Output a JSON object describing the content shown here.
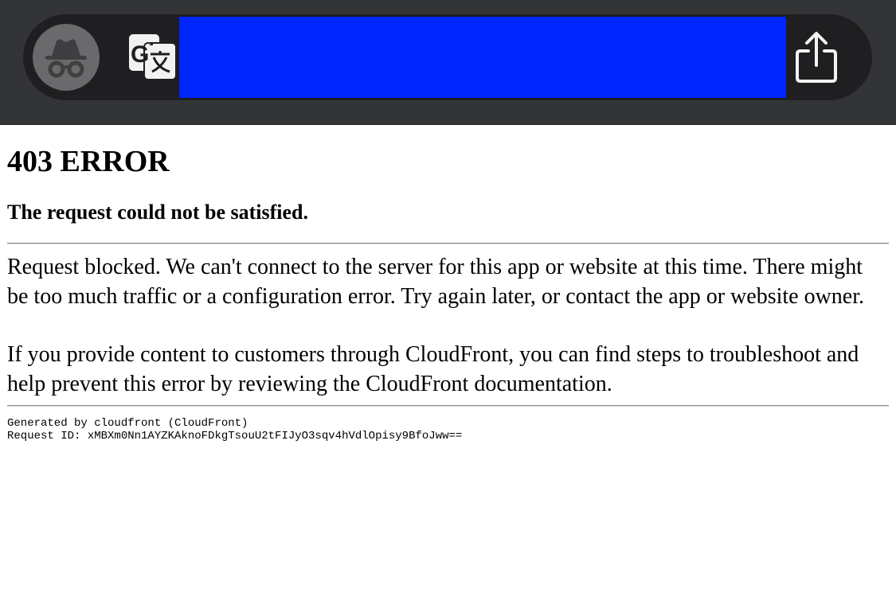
{
  "browser": {
    "address_text": "",
    "icons": {
      "incognito": "incognito-icon",
      "translate": "translate-icon",
      "share": "share-icon"
    },
    "colors": {
      "toolbar": "#333436",
      "address_highlight": "#0026ff"
    }
  },
  "page": {
    "heading": "403 ERROR",
    "subheading": "The request could not be satisfied.",
    "paragraph1": "Request blocked. We can't connect to the server for this app or website at this time. There might be too much traffic or a configuration error. Try again later, or contact the app or website owner.",
    "paragraph2": "If you provide content to customers through CloudFront, you can find steps to troubleshoot and help prevent this error by reviewing the CloudFront documentation.",
    "footer_generated": "Generated by cloudfront (CloudFront)",
    "footer_request_id": "Request ID: xMBXm0Nn1AYZKAknoFDkgTsouU2tFIJyO3sqv4hVdlOpisy9BfoJww=="
  }
}
